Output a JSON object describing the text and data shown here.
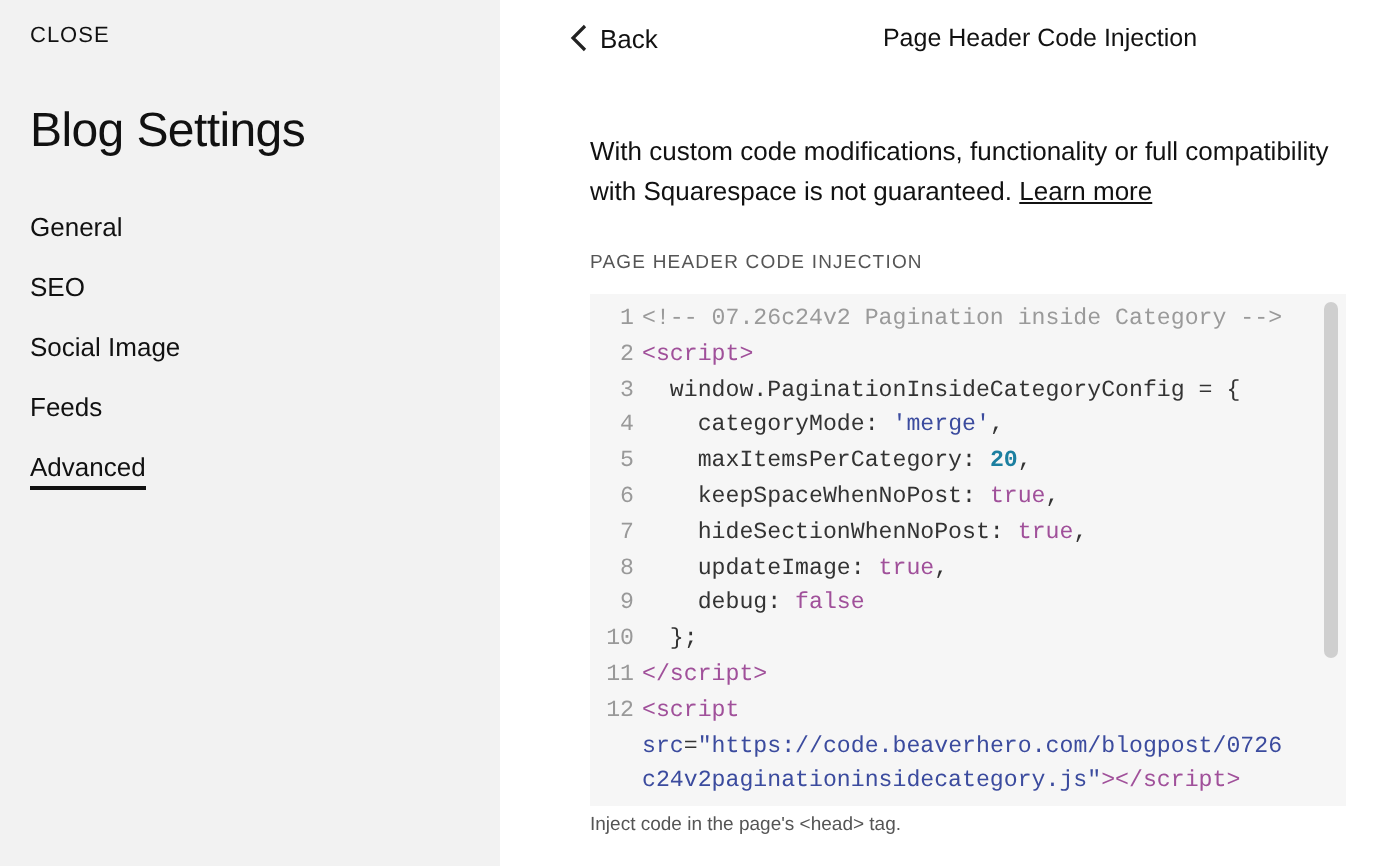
{
  "sidebar": {
    "close": "CLOSE",
    "title": "Blog Settings",
    "items": [
      {
        "label": "General",
        "selected": false
      },
      {
        "label": "SEO",
        "selected": false
      },
      {
        "label": "Social Image",
        "selected": false
      },
      {
        "label": "Feeds",
        "selected": false
      },
      {
        "label": "Advanced",
        "selected": true
      }
    ]
  },
  "header": {
    "back": "Back",
    "title": "Page Header Code Injection"
  },
  "notice": {
    "text": "With custom code modifications, functionality or full compatibility with Squarespace is not guaranteed.",
    "link": "Learn more"
  },
  "field": {
    "label": "PAGE HEADER CODE INJECTION",
    "hint": "Inject code in the page's <head> tag.",
    "lines": [
      {
        "number": "1",
        "tokens": [
          {
            "kind": "comment",
            "text": "<!-- 07.26c24v2 Pagination inside Category -->"
          }
        ]
      },
      {
        "number": "2",
        "tokens": [
          {
            "kind": "tag",
            "text": "<script>"
          }
        ]
      },
      {
        "number": "3",
        "tokens": [
          {
            "kind": "plain",
            "text": "  window.PaginationInsideCategoryConfig = {"
          }
        ]
      },
      {
        "number": "4",
        "tokens": [
          {
            "kind": "plain",
            "text": "    categoryMode: "
          },
          {
            "kind": "string",
            "text": "'merge'"
          },
          {
            "kind": "plain",
            "text": ","
          }
        ]
      },
      {
        "number": "5",
        "tokens": [
          {
            "kind": "plain",
            "text": "    maxItemsPerCategory: "
          },
          {
            "kind": "number",
            "text": "20"
          },
          {
            "kind": "plain",
            "text": ","
          }
        ]
      },
      {
        "number": "6",
        "tokens": [
          {
            "kind": "plain",
            "text": "    keepSpaceWhenNoPost: "
          },
          {
            "kind": "keyword",
            "text": "true"
          },
          {
            "kind": "plain",
            "text": ","
          }
        ]
      },
      {
        "number": "7",
        "tokens": [
          {
            "kind": "plain",
            "text": "    hideSectionWhenNoPost: "
          },
          {
            "kind": "keyword",
            "text": "true"
          },
          {
            "kind": "plain",
            "text": ","
          }
        ]
      },
      {
        "number": "8",
        "tokens": [
          {
            "kind": "plain",
            "text": "    updateImage: "
          },
          {
            "kind": "keyword",
            "text": "true"
          },
          {
            "kind": "plain",
            "text": ","
          }
        ]
      },
      {
        "number": "9",
        "tokens": [
          {
            "kind": "plain",
            "text": "    debug: "
          },
          {
            "kind": "keyword",
            "text": "false"
          }
        ]
      },
      {
        "number": "10",
        "tokens": [
          {
            "kind": "plain",
            "text": "  };"
          }
        ]
      },
      {
        "number": "11",
        "tokens": [
          {
            "kind": "tag",
            "text": "</script>"
          }
        ]
      },
      {
        "number": "12",
        "tokens": [
          {
            "kind": "tag",
            "text": "<script"
          }
        ],
        "continuation": [
          [
            {
              "kind": "attr",
              "text": "src"
            },
            {
              "kind": "plain",
              "text": "="
            },
            {
              "kind": "string",
              "text": "\"https://code.beaverhero.com/blogpost/0726"
            }
          ],
          [
            {
              "kind": "string",
              "text": "c24v2paginationinsidecategory.js\""
            },
            {
              "kind": "tag",
              "text": "></script>"
            }
          ]
        ]
      }
    ]
  }
}
